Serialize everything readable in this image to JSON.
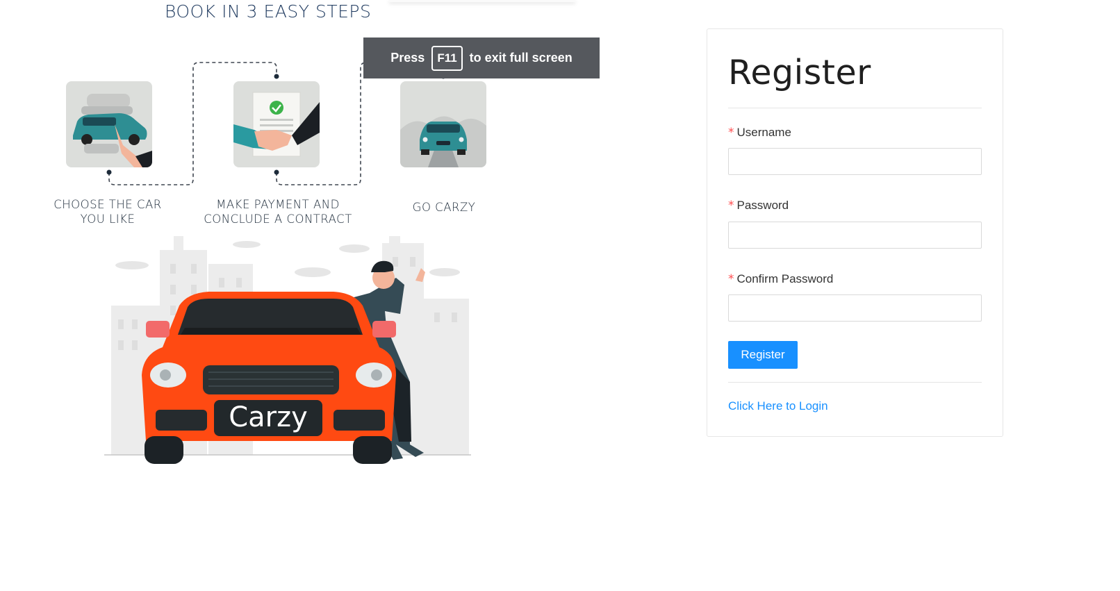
{
  "left": {
    "heading": "BOOK IN 3 EASY STEPS",
    "steps": [
      {
        "line1": "CHOOSE THE CAR",
        "line2": "YOU LIKE"
      },
      {
        "line1": "MAKE PAYMENT AND",
        "line2": "CONCLUDE A CONTRACT"
      },
      {
        "line1": "GO CARZY",
        "line2": ""
      }
    ],
    "plate_text": "Carzy"
  },
  "fullscreen_banner": {
    "press": "Press",
    "key": "F11",
    "message": "to exit full screen"
  },
  "register": {
    "title": "Register",
    "required_mark": "*",
    "username_label": "Username",
    "password_label": "Password",
    "confirm_label": "Confirm Password",
    "username_value": "",
    "password_value": "",
    "confirm_value": "",
    "submit_label": "Register",
    "login_link": "Click Here to Login"
  },
  "colors": {
    "primary": "#1890ff",
    "required": "#ff4d4f",
    "car": "#ff4a12",
    "step_teal": "#2a9aa0"
  }
}
